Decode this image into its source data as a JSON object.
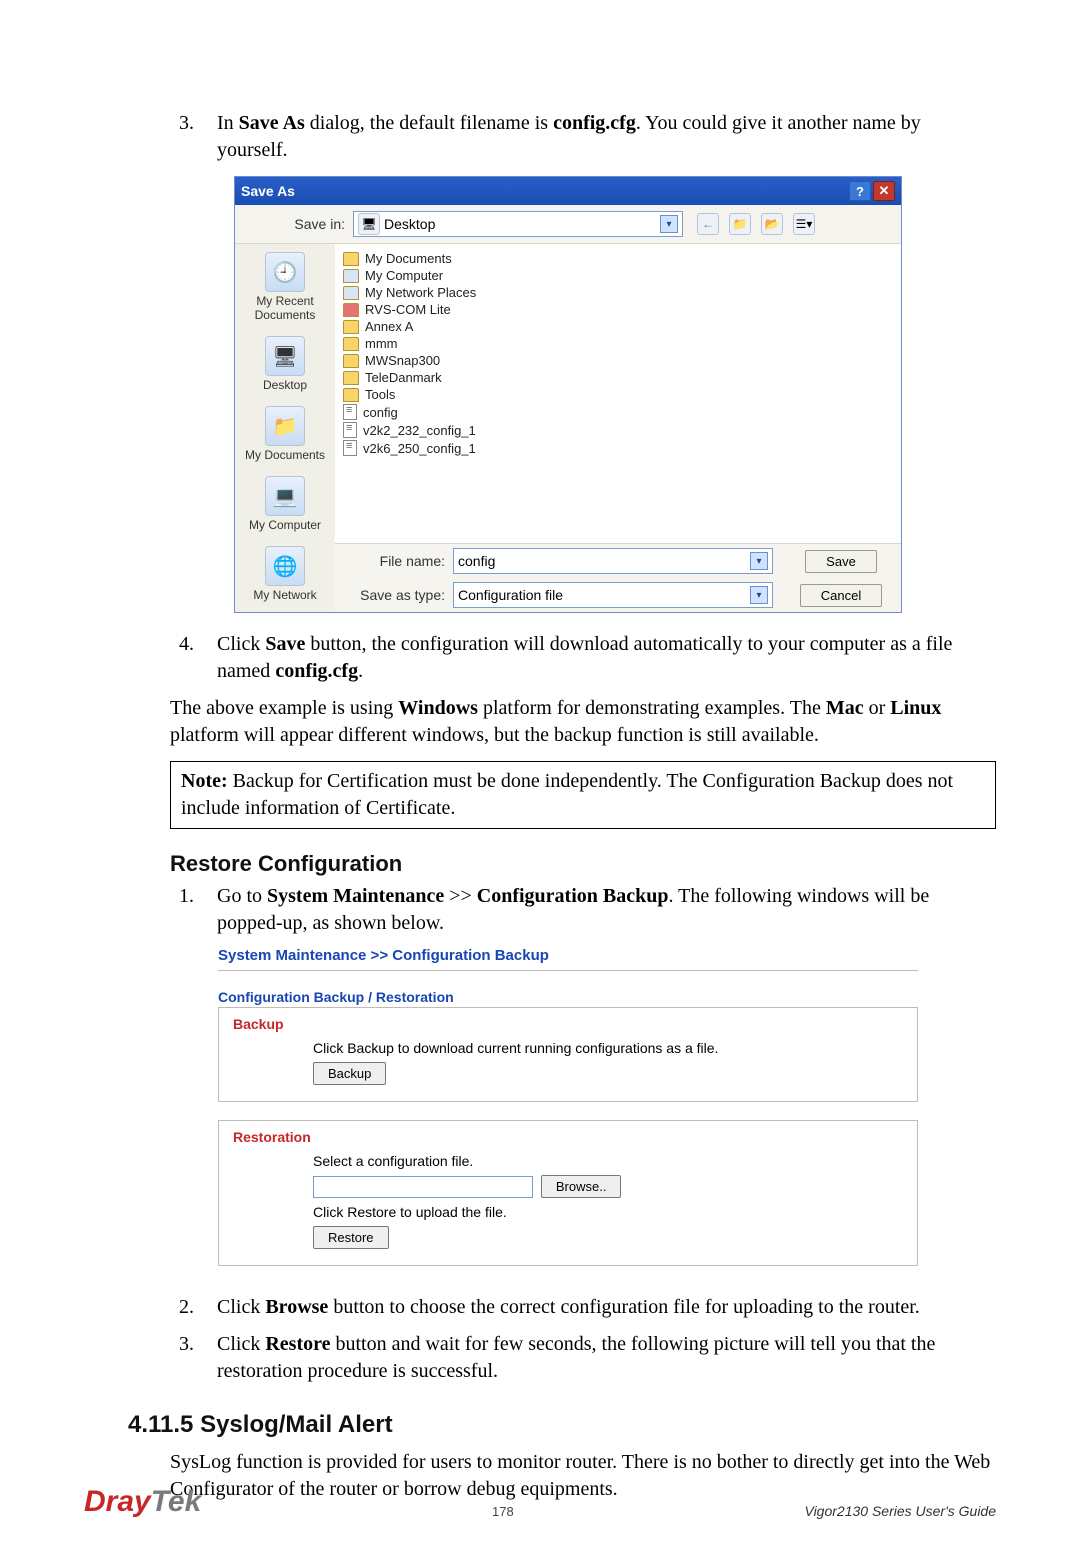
{
  "step3": {
    "prefix": "In ",
    "bold1": "Save As",
    "mid1": " dialog, the default filename is ",
    "bold2": "config.cfg",
    "suffix": ". You could give it another name by yourself."
  },
  "saveAs": {
    "title": "Save As",
    "saveInLabel": "Save in:",
    "saveInValue": "Desktop",
    "places": {
      "recent": "My Recent Documents",
      "desktop": "Desktop",
      "mydocs": "My Documents",
      "mycomp": "My Computer",
      "mynet": "My Network"
    },
    "files": {
      "mydocuments": "My Documents",
      "mycomputer": "My Computer",
      "mynetworkplaces": "My Network Places",
      "rvscom": "RVS-COM Lite",
      "annexa": "Annex A",
      "mmm": "mmm",
      "mwsnap": "MWSnap300",
      "teledanmark": "TeleDanmark",
      "tools": "Tools",
      "config": "config",
      "v2k2": "v2k2_232_config_1",
      "v2k6": "v2k6_250_config_1"
    },
    "fileNameLabel": "File name:",
    "fileNameValue": "config",
    "saveTypeLabel": "Save as type:",
    "saveTypeValue": "Configuration file",
    "saveBtn": "Save",
    "cancelBtn": "Cancel",
    "helpGlyph": "?",
    "closeGlyph": "✕"
  },
  "step4": {
    "prefix": "Click ",
    "bold1": "Save",
    "mid1": " button, the configuration will download automatically to your computer as a file named ",
    "bold2": "config.cfg",
    "suffix": "."
  },
  "platformPara": {
    "prefix": "The above example is using ",
    "bold1": "Windows",
    "mid1": " platform for demonstrating examples. The ",
    "bold2": "Mac",
    "mid2": " or ",
    "bold3": "Linux",
    "suffix": " platform will appear different windows, but the backup function is still available."
  },
  "note": {
    "bold": "Note:",
    "text": " Backup for Certification must be done independently. The Configuration Backup does not include information of Certificate."
  },
  "restore": {
    "heading": "Restore Configuration",
    "step1": {
      "prefix": "Go to ",
      "bold1": "System Maintenance",
      "mid1": " >> ",
      "bold2": "Configuration Backup",
      "suffix": ". The following windows will be popped-up, as shown below."
    },
    "step2": {
      "prefix": "Click ",
      "bold1": "Browse",
      "suffix": " button to choose the correct configuration file for uploading to the router."
    },
    "step3": {
      "prefix": "Click ",
      "bold1": "Restore",
      "suffix": " button and wait for few seconds, the following picture will tell you that the restoration procedure is successful."
    }
  },
  "cfg": {
    "breadcrumb": "System Maintenance >> Configuration Backup",
    "subtitle": "Configuration Backup / Restoration",
    "backup": {
      "title": "Backup",
      "desc": "Click Backup to download current running configurations as a file.",
      "btn": "Backup"
    },
    "restoration": {
      "title": "Restoration",
      "desc1": "Select a configuration file.",
      "browseBtn": "Browse..",
      "desc2": "Click Restore to upload the file.",
      "btn": "Restore"
    }
  },
  "section": {
    "heading": "4.11.5 Syslog/Mail Alert",
    "body": "SysLog function is provided for users to monitor router. There is no bother to directly get into the Web Configurator of the router or borrow debug equipments."
  },
  "footer": {
    "logo_red": "Dray",
    "logo_gray": "Tek",
    "page": "178",
    "guide": "Vigor2130  Series  User's  Guide"
  }
}
